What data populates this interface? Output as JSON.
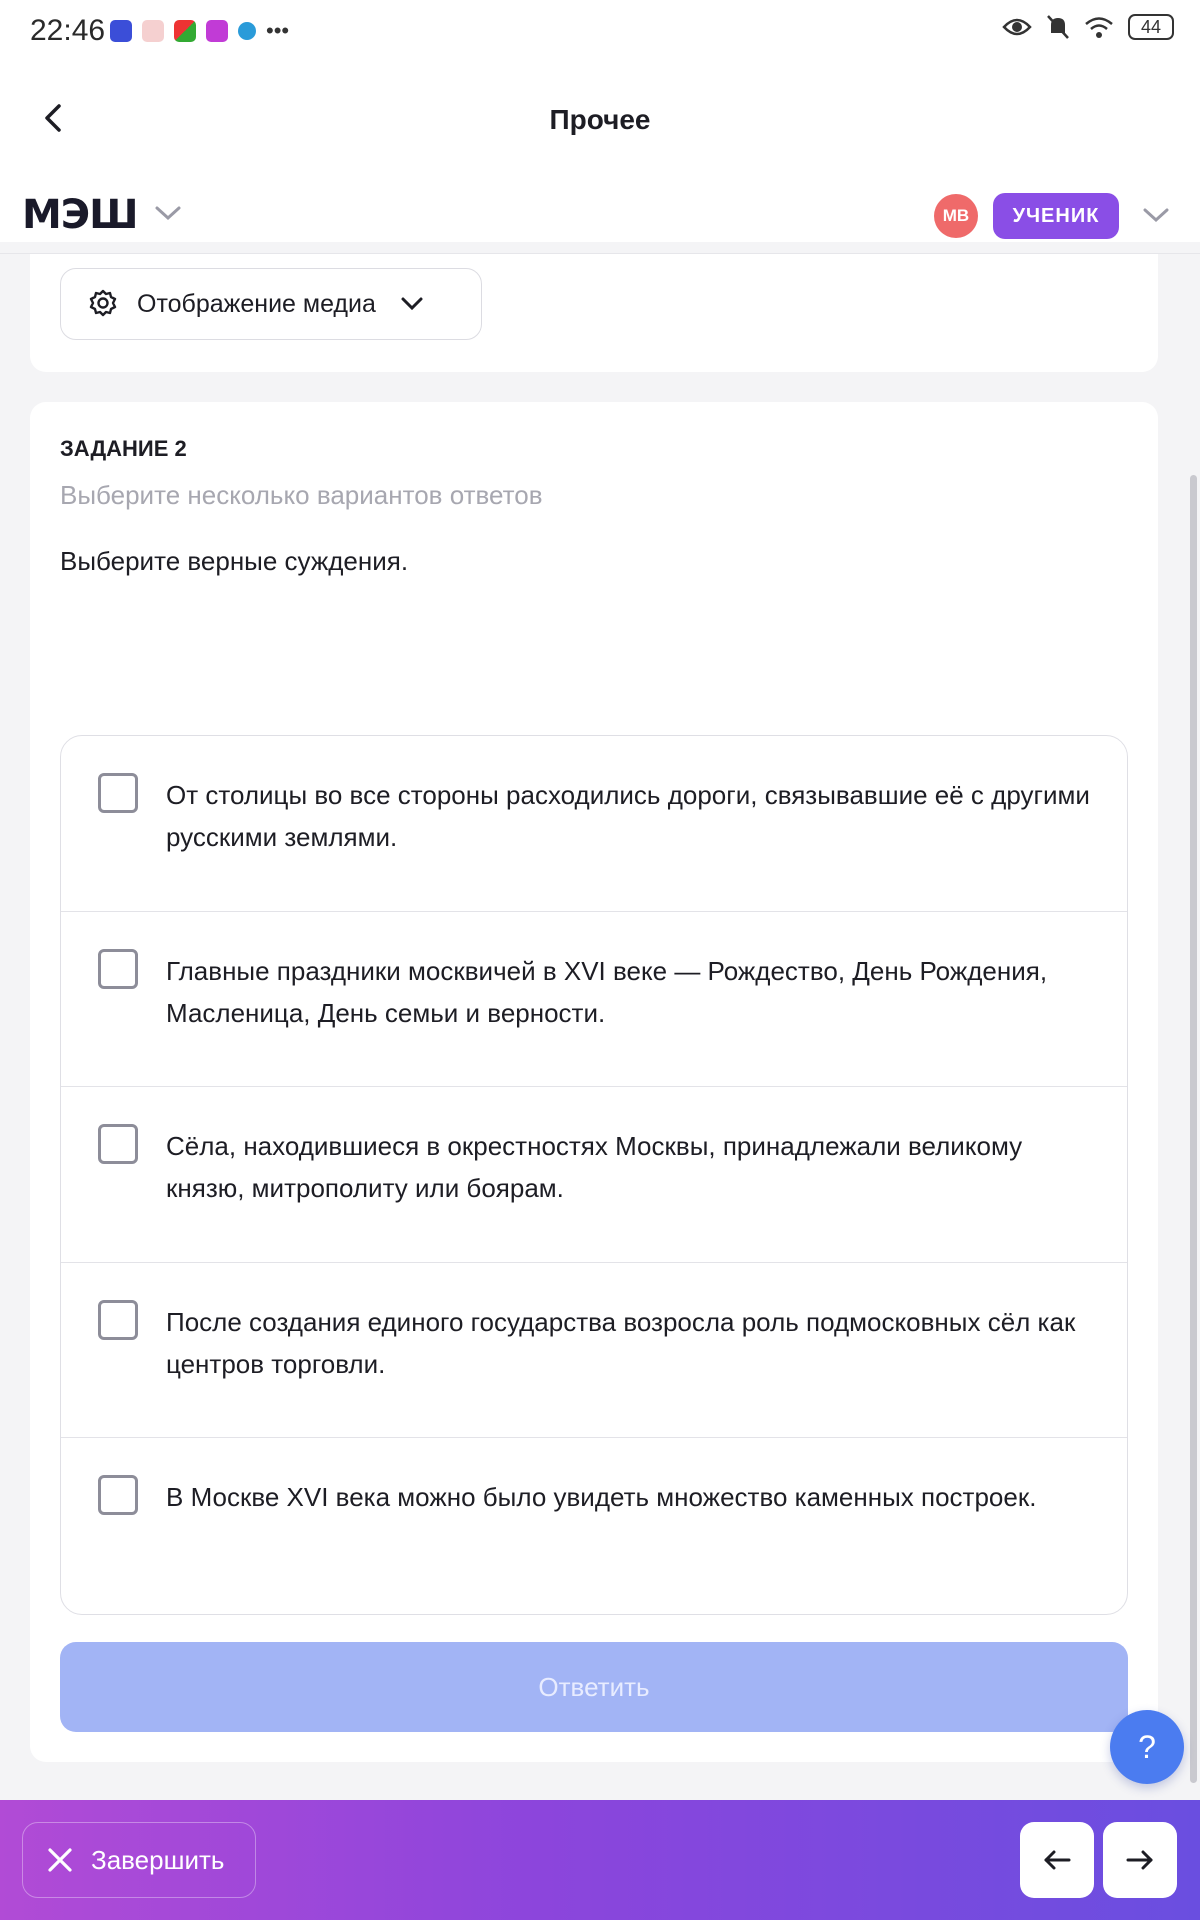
{
  "status_bar": {
    "time": "22:46",
    "battery": "44"
  },
  "header": {
    "title": "Прочее"
  },
  "brand": {
    "logo_text": "МЭШ"
  },
  "user": {
    "initials": "МВ",
    "role": "УЧЕНИК"
  },
  "media": {
    "label": "Отображение медиа"
  },
  "task": {
    "title": "ЗАДАНИЕ 2",
    "hint": "Выберите несколько вариантов ответов",
    "question": "Выберите верные суждения.",
    "options": [
      {
        "text": "От столицы во все стороны расходились дороги, связывавшие её с другими русскими землями.",
        "checked": false
      },
      {
        "text": "Главные праздники москвичей в XVI веке — Рождество, День Рождения, Масленица, День семьи и верности.",
        "checked": false
      },
      {
        "text": "Сёла, находившиеся в окрестностях Москвы, принадлежали великому князю, митрополиту или боярам.",
        "checked": false
      },
      {
        "text": "После создания единого государства возросла роль подмосковных сёл как центров торговли.",
        "checked": false
      },
      {
        "text": "В Москве XVI века можно было увидеть множество каменных построек.",
        "checked": false
      }
    ],
    "submit_label": "Ответить"
  },
  "help": {
    "label": "?"
  },
  "footer": {
    "finish_label": "Завершить"
  },
  "colors": {
    "accent": "#8a4ee6",
    "avatar": "#ef6a6a",
    "submit_disabled": "#a2b4f5",
    "help": "#4b7cf0"
  }
}
